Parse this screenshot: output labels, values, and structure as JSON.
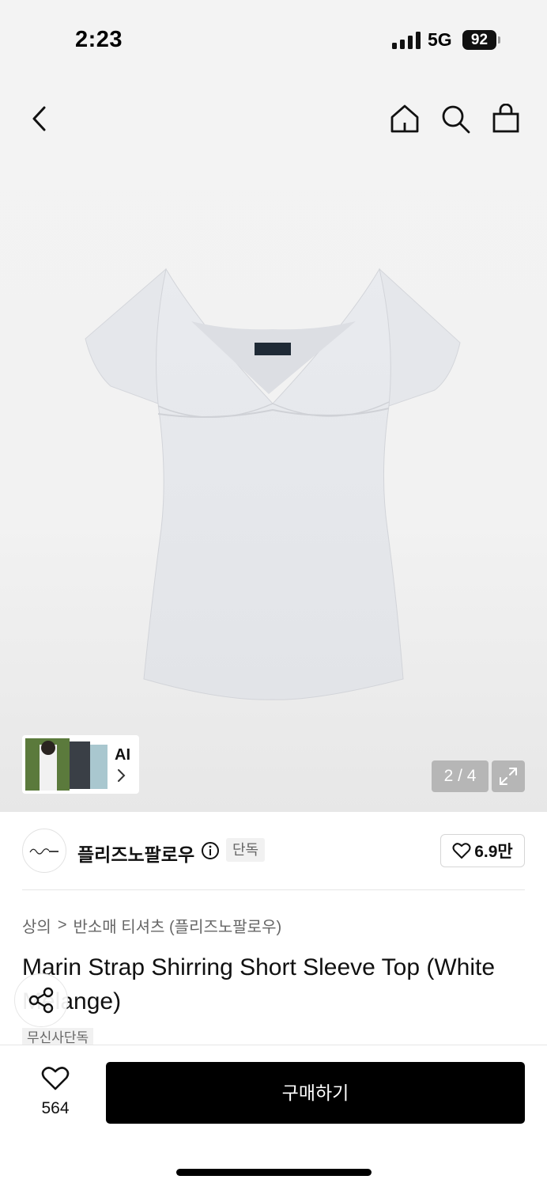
{
  "status": {
    "time": "2:23",
    "network": "5G",
    "battery": "92"
  },
  "icons": {
    "back": "chevron-left-icon",
    "home": "home-icon",
    "search": "search-icon",
    "bag": "shopping-bag-icon",
    "expand": "expand-icon",
    "info": "info-icon",
    "heart": "heart-icon",
    "share": "share-icon"
  },
  "gallery": {
    "pager": "2 / 4",
    "ai_label": "AI"
  },
  "brand": {
    "name": "플리즈노팔로우",
    "badge": "단독",
    "likes": "6.9만"
  },
  "breadcrumb": {
    "category": "상의",
    "separator": ">",
    "subcategory": "반소매 티셔츠 (플리즈노팔로우)"
  },
  "product": {
    "title": "Marin Strap Shirring Short Sleeve Top (White Melange)",
    "tag": "무신사단독"
  },
  "bottom": {
    "wish_count": "564",
    "buy_label": "구매하기"
  },
  "colors": {
    "accent": "#000000",
    "product": "#e6e8ec"
  }
}
